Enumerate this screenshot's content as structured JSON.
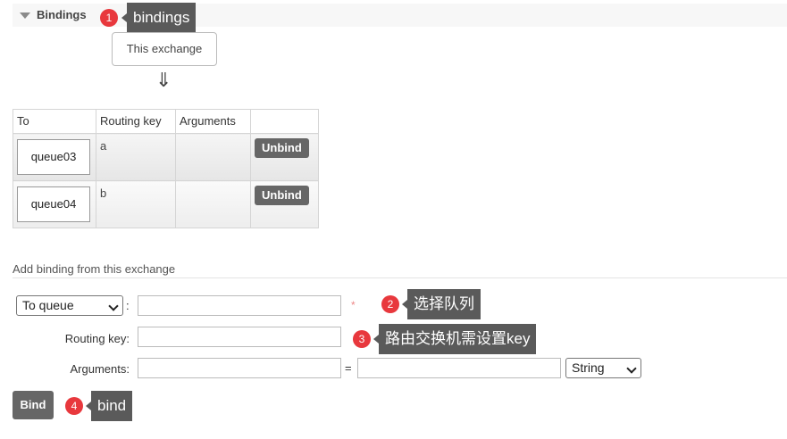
{
  "section": {
    "title": "Bindings"
  },
  "source_node": {
    "label": "This exchange",
    "arrow": "⇓"
  },
  "table": {
    "headers": [
      "To",
      "Routing key",
      "Arguments",
      ""
    ],
    "rows": [
      {
        "to": "queue03",
        "routing_key": "a",
        "arguments": "",
        "action": "Unbind"
      },
      {
        "to": "queue04",
        "routing_key": "b",
        "arguments": "",
        "action": "Unbind"
      }
    ]
  },
  "add_binding": {
    "title": "Add binding from this exchange",
    "destination_type": "To queue",
    "destination_value": "",
    "required_marker": "*",
    "routing_key_label": "Routing key:",
    "routing_key_value": "",
    "arguments_label": "Arguments:",
    "arguments_key": "",
    "equals": "=",
    "arguments_value": "",
    "arguments_type": "String",
    "colon": ":",
    "bind_label": "Bind"
  },
  "annotations": [
    {
      "number": "1",
      "text": "bindings"
    },
    {
      "number": "2",
      "text": "选择队列"
    },
    {
      "number": "3",
      "text": "路由交换机需设置key"
    },
    {
      "number": "4",
      "text": "bind"
    }
  ],
  "colors": {
    "badge": "#e8383d",
    "callout": "#5a5a5a",
    "button": "#666666"
  }
}
